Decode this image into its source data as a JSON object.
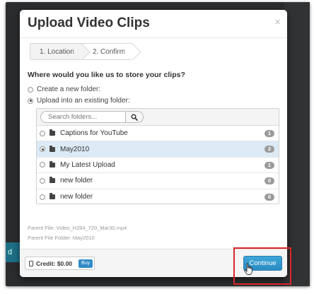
{
  "modal": {
    "title": "Upload Video Clips",
    "close_label": "×"
  },
  "steps": [
    {
      "label": "1. Location"
    },
    {
      "label": "2. Confirm"
    }
  ],
  "question": "Where would you like us to store your clips?",
  "options": {
    "create_new": "Create a new folder:",
    "upload_existing": "Upload into an existing folder:"
  },
  "search": {
    "placeholder": "Search folders..."
  },
  "folders": [
    {
      "name": "Captions for YouTube",
      "count": "1",
      "selected": false
    },
    {
      "name": "May2010",
      "count": "2",
      "selected": true
    },
    {
      "name": "My Latest Upload",
      "count": "1",
      "selected": false
    },
    {
      "name": "new folder",
      "count": "0",
      "selected": false
    },
    {
      "name": "new folder",
      "count": "0",
      "selected": false
    }
  ],
  "parent": {
    "file": "Parent File: Video_H264_720_Mar30.mp4",
    "folder": "Parent File Folder: May2010"
  },
  "footer": {
    "credit": "Credit: $0.00",
    "buy_label": "Buy",
    "continue_label": "Continue"
  },
  "background": {
    "teal_text": "d"
  },
  "colors": {
    "primary": "#2f8bc7",
    "selected_row": "#dceaf6",
    "highlight": "#d9262b"
  }
}
